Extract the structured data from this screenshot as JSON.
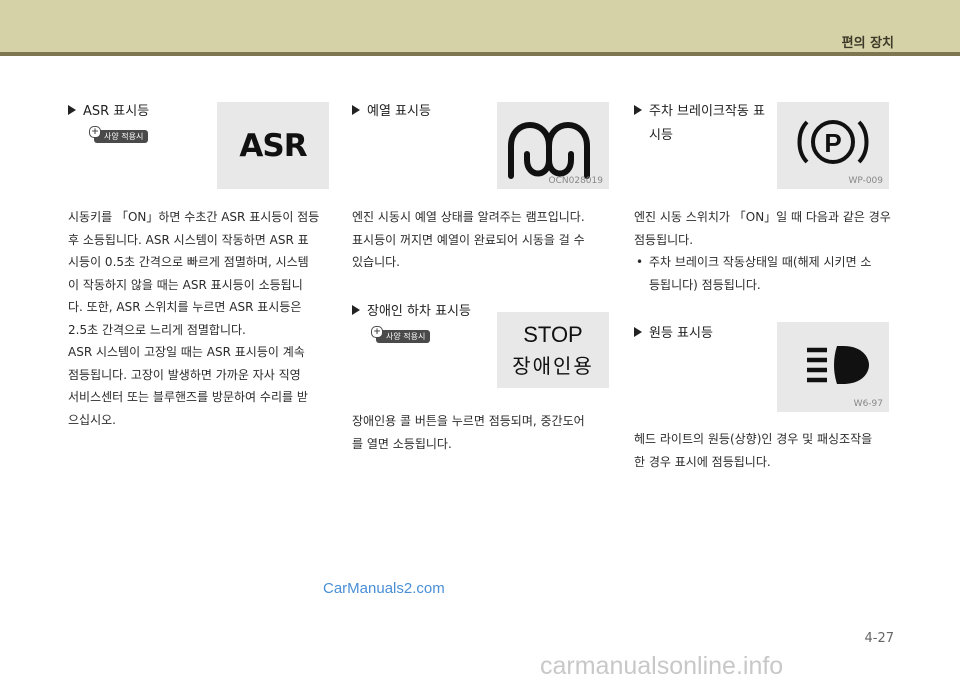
{
  "header": {
    "section": "편의 장치"
  },
  "col1": {
    "heading": "ASR 표시등",
    "badge": "사양 적용시",
    "icon_text": "ASR",
    "para": [
      "시동키를 「ON」하면 수초간 ASR 표시등이 점등",
      "후 소등됩니다. ASR 시스템이 작동하면 ASR 표",
      "시등이 0.5초 간격으로 빠르게 점멸하며, 시스템",
      "이 작동하지 않을 때는 ASR 표시등이 소등됩니",
      "다. 또한, ASR 스위치를 누르면 ASR 표시등은",
      "2.5초 간격으로 느리게 점멸합니다.",
      "ASR 시스템이 고장일 때는 ASR 표시등이 계속",
      "점등됩니다. 고장이 발생하면 가까운 자사 직영",
      "서비스센터 또는 블루핸즈를 방문하여 수리를 받",
      "으십시오."
    ]
  },
  "col2": {
    "heading1": "예열 표시등",
    "code1": "OCN028019",
    "para1": [
      "엔진 시동시 예열 상태를 알려주는 램프입니다.",
      "표시등이 꺼지면 예열이 완료되어 시동을 걸 수",
      "있습니다."
    ],
    "heading2": "장애인 하차 표시등",
    "badge": "사양 적용시",
    "stop_line1": "STOP",
    "stop_line2": "장애인용",
    "para2": [
      "장애인용 콜 버튼을 누르면 점등되며, 중간도어",
      "를 열면 소등됩니다."
    ]
  },
  "col3": {
    "heading1_line1": "주차 브레이크작동 표",
    "heading1_line2": "시등",
    "code1": "WP-009",
    "para1": [
      "엔진 시동 스위치가 「ON」일 때 다음과 같은 경우",
      "점등됩니다."
    ],
    "bullet_line1": "주차 브레이크 작동상태일 때(해제 시키면 소",
    "bullet_line2": "등됩니다) 점등됩니다.",
    "heading2": "원등 표시등",
    "code2": "W6-97",
    "para2": [
      "헤드 라이트의 원등(상향)인 경우 및 패싱조작을",
      "한 경우 표시에 점등됩니다."
    ]
  },
  "watermark": "CarManuals2.com",
  "page_number": "4-27",
  "footer_watermark": "carmanualsonline.info"
}
